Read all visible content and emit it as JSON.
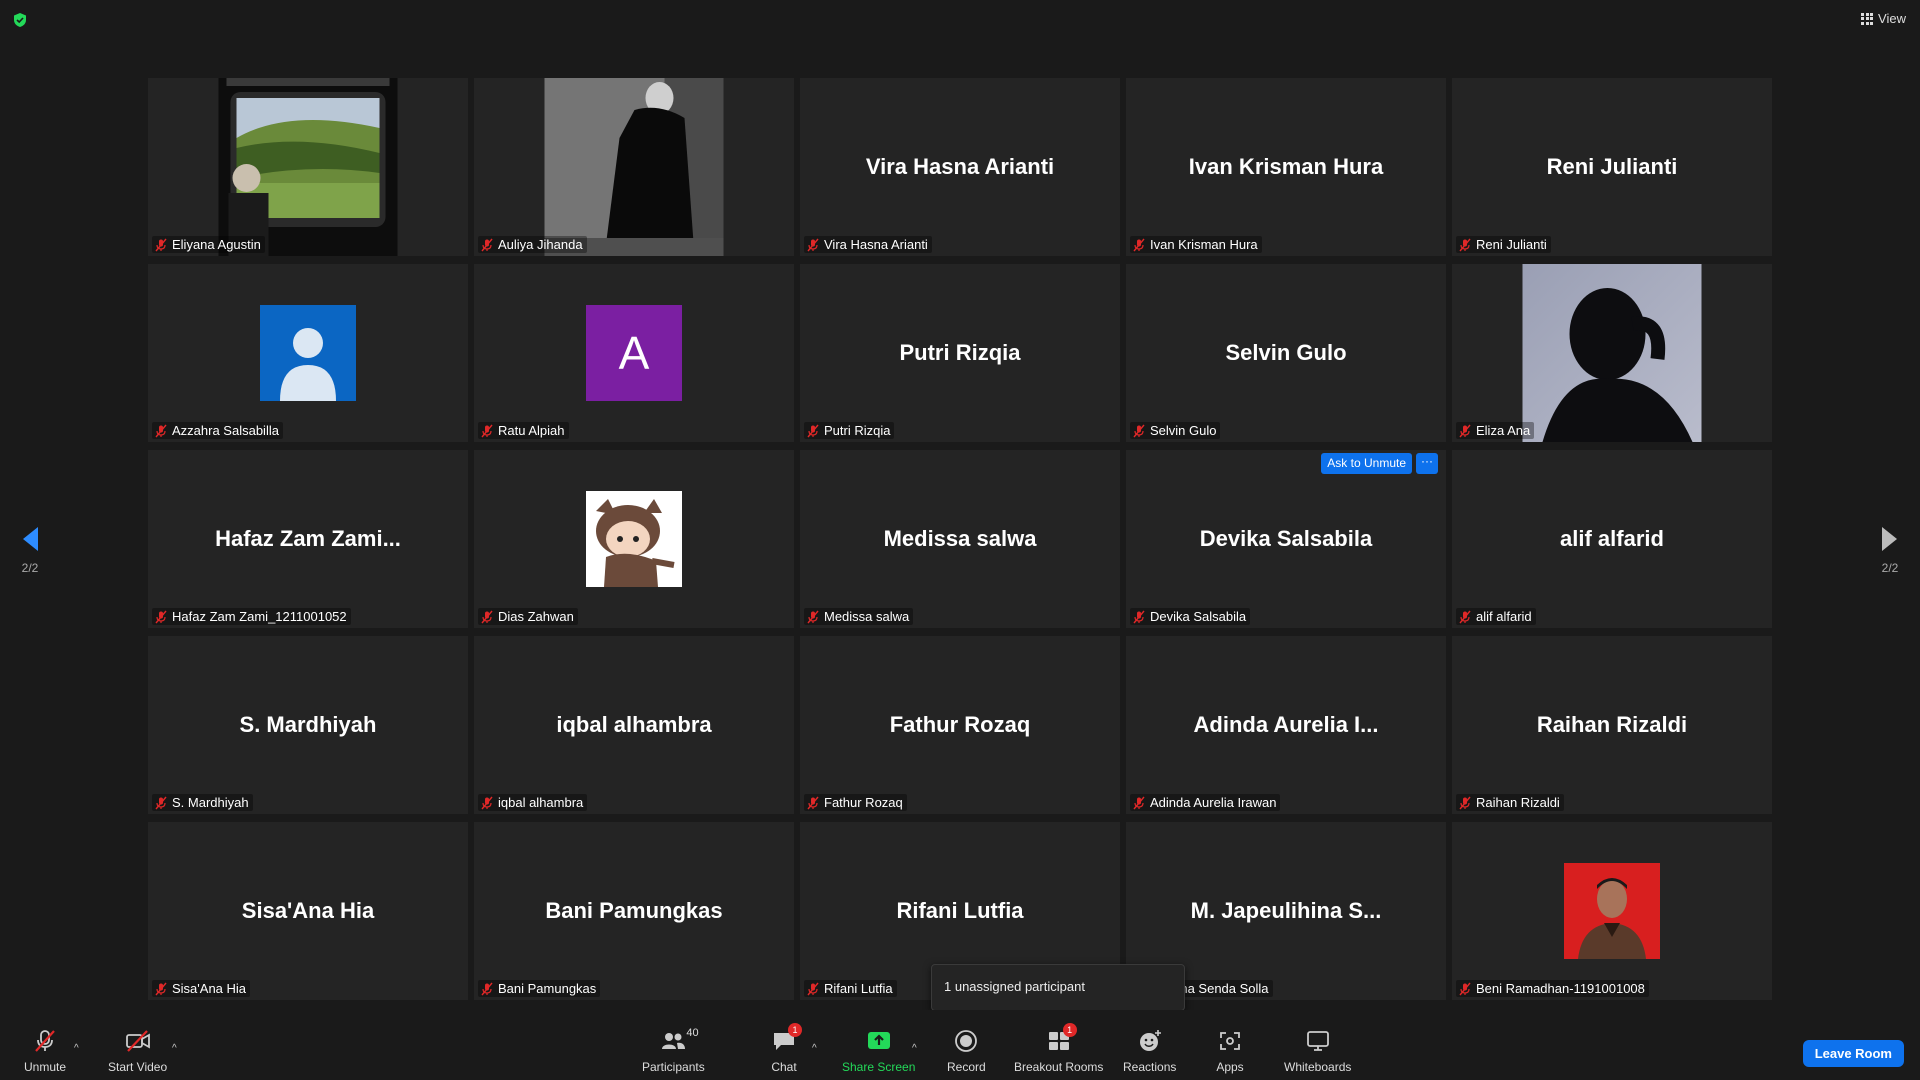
{
  "window": {
    "view_label": "View"
  },
  "pager": {
    "left_label": "2/2",
    "right_label": "2/2"
  },
  "participants": [
    {
      "label": "Eliyana Agustin",
      "display": "photo-train"
    },
    {
      "label": "Auliya Jihanda",
      "display": "photo-dark"
    },
    {
      "label": "Vira Hasna Arianti",
      "display": "name",
      "big_name": "Vira Hasna Arianti"
    },
    {
      "label": "Ivan Krisman Hura",
      "display": "name",
      "big_name": "Ivan Krisman Hura"
    },
    {
      "label": "Reni Julianti",
      "display": "name",
      "big_name": "Reni Julianti"
    },
    {
      "label": "Azzahra Salsabilla",
      "display": "avatar-default"
    },
    {
      "label": "Ratu Alpiah",
      "display": "avatar-letter",
      "letter": "A"
    },
    {
      "label": "Putri Rizqia",
      "display": "name",
      "big_name": "Putri Rizqia"
    },
    {
      "label": "Selvin Gulo",
      "display": "name",
      "big_name": "Selvin Gulo"
    },
    {
      "label": "Eliza Ana",
      "display": "photo-silhouette"
    },
    {
      "label": "Hafaz Zam Zami_1211001052",
      "display": "name",
      "big_name": "Hafaz Zam Zami..."
    },
    {
      "label": "Dias Zahwan",
      "display": "avatar-cartoon"
    },
    {
      "label": "Medissa salwa",
      "display": "name",
      "big_name": "Medissa salwa"
    },
    {
      "label": "Devika Salsabila",
      "display": "name",
      "big_name": "Devika Salsabila",
      "ask_unmute": "Ask to Unmute",
      "more": "···"
    },
    {
      "label": "alif alfarid",
      "display": "name",
      "big_name": "alif alfarid"
    },
    {
      "label": "S. Mardhiyah",
      "display": "name",
      "big_name": "S. Mardhiyah"
    },
    {
      "label": "iqbal alhambra",
      "display": "name",
      "big_name": "iqbal alhambra"
    },
    {
      "label": "Fathur Rozaq",
      "display": "name",
      "big_name": "Fathur Rozaq"
    },
    {
      "label": "Adinda Aurelia Irawan",
      "display": "name",
      "big_name": "Adinda Aurelia I..."
    },
    {
      "label": "Raihan Rizaldi",
      "display": "name",
      "big_name": "Raihan Rizaldi"
    },
    {
      "label": "Sisa'Ana Hia",
      "display": "name",
      "big_name": "Sisa'Ana Hia"
    },
    {
      "label": "Bani Pamungkas",
      "display": "name",
      "big_name": "Bani Pamungkas"
    },
    {
      "label": "Rifani Lutfia",
      "display": "name",
      "big_name": "Rifani Lutfia"
    },
    {
      "label": "eulihina Senda Solla",
      "display": "name",
      "big_name": "M. Japeulihina S..."
    },
    {
      "label": "Beni Ramadhan-1191001008",
      "display": "photo-portrait"
    }
  ],
  "tooltip": {
    "text": "1 unassigned participant"
  },
  "toolbar": {
    "unmute": "Unmute",
    "start_video": "Start Video",
    "participants": "Participants",
    "participants_count": "40",
    "chat": "Chat",
    "chat_badge": "1",
    "share_screen": "Share Screen",
    "record": "Record",
    "breakout_rooms": "Breakout Rooms",
    "breakout_badge": "1",
    "reactions": "Reactions",
    "apps": "Apps",
    "whiteboards": "Whiteboards",
    "leave_room": "Leave Room"
  },
  "colors": {
    "accent": "#0e72ed",
    "share_green": "#23d959",
    "muted_red": "#e02828",
    "tile_bg": "#242424"
  }
}
